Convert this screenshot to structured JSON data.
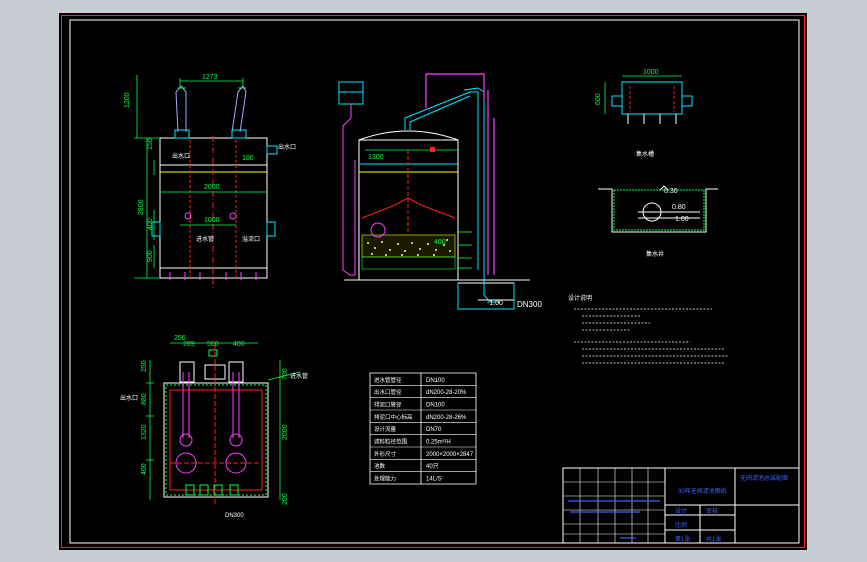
{
  "dims": {
    "w1273": "1273",
    "h1200": "1200",
    "h2800": "2800",
    "w2000": "2000",
    "w1000": "1000",
    "h400": "400",
    "h900": "900",
    "h150": "150",
    "w100": "100",
    "w1300": "1300",
    "h400b": "400",
    "w256": "256",
    "w289": "289",
    "w500": "500",
    "w400": "400",
    "h250": "250",
    "h880": "880",
    "h1320": "1320",
    "h400c": "400",
    "h700": "700",
    "h2000": "2000",
    "h200": "200",
    "trough_w": "1000",
    "trough_h": "600"
  },
  "labels": {
    "outlet1": "出水口",
    "outlet2": "出水口",
    "outlet3": "出水口",
    "inlet_pipe": "进水管",
    "overflow": "溢流口",
    "dn_left": "DN300",
    "dn300": "DN300",
    "lvl_top": "0.30",
    "lvl_mid": "0.80",
    "lvl_low": "1.00",
    "lvl_neg": "-1.00",
    "trough_caption": "集水槽",
    "pit_caption": "集水井",
    "notes_title": "设计说明"
  },
  "spec_table": [
    [
      "进水管管径",
      "DN100"
    ],
    [
      "出水口管径",
      "dN200-28-20%"
    ],
    [
      "排泥口管径",
      "DN100"
    ],
    [
      "排泥口中心标高",
      "dN200-28-26%"
    ],
    [
      "设计流量",
      "DN70"
    ],
    [
      "滤料粒径范围",
      "0.25m²/H"
    ],
    [
      "外形尺寸",
      "2000×2000×2847"
    ],
    [
      "池数",
      "40只"
    ],
    [
      "处理能力",
      "14L/S"
    ]
  ],
  "title_block": {
    "project": "30吨无阀滤池图纸",
    "drawing": "无阀滤池总装配图",
    "cell_a": "设计",
    "cell_b": "审核",
    "scale": "比例",
    "sheet1": "第1张",
    "sheet2": "共1张"
  },
  "colors": {
    "red": "#ff2020",
    "cyan": "#00e5ff",
    "green": "#00ff40",
    "yellow": "#ffff00",
    "white": "#ffffff",
    "magenta": "#ff40ff",
    "blue": "#4060ff"
  }
}
